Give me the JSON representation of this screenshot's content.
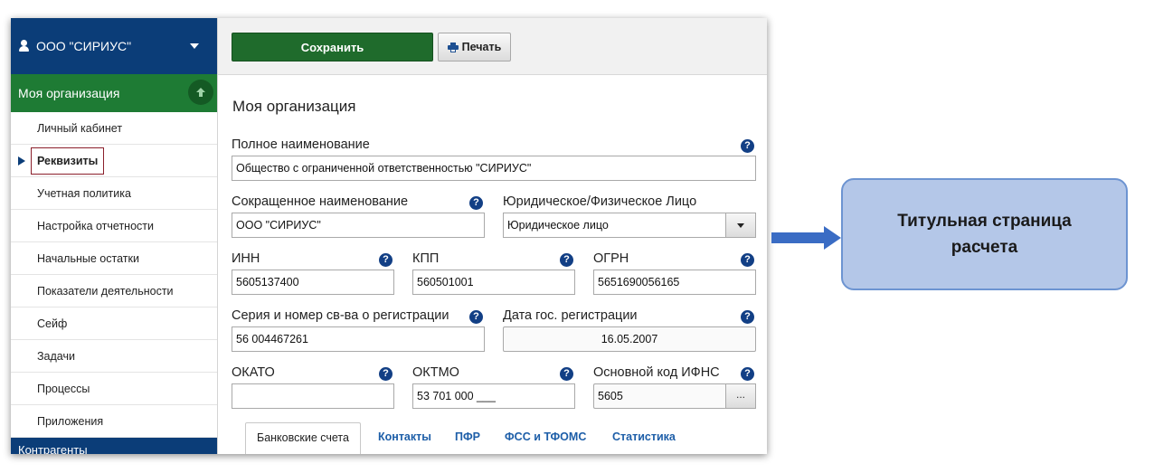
{
  "sidebar": {
    "org_name": "ООО \"СИРИУС\"",
    "section_title": "Моя организация",
    "items": [
      {
        "label": "Личный кабинет"
      },
      {
        "label": "Реквизиты"
      },
      {
        "label": "Учетная политика"
      },
      {
        "label": "Настройка отчетности"
      },
      {
        "label": "Начальные остатки"
      },
      {
        "label": "Показатели деятельности"
      },
      {
        "label": "Сейф"
      },
      {
        "label": "Задачи"
      },
      {
        "label": "Процессы"
      },
      {
        "label": "Приложения"
      }
    ],
    "active_item": "Реквизиты",
    "next_section_partial": "Контрагенты"
  },
  "toolbar": {
    "save_label": "Сохранить",
    "print_label": "Печать"
  },
  "main": {
    "title": "Моя организация",
    "full_name": {
      "label": "Полное наименование",
      "value": "Общество с ограниченной ответственностью \"СИРИУС\""
    },
    "short_name": {
      "label": "Сокращенное наименование",
      "value": "ООО \"СИРИУС\""
    },
    "entity_type": {
      "label": "Юридическое/Физическое Лицо",
      "value": "Юридическое лицо"
    },
    "inn": {
      "label": "ИНН",
      "value": "5605137400"
    },
    "kpp": {
      "label": "КПП",
      "value": "560501001"
    },
    "ogrn": {
      "label": "ОГРН",
      "value": "5651690056165"
    },
    "reg_cert": {
      "label": "Серия и номер св-ва о регистрации",
      "value": "56 004467261"
    },
    "reg_date": {
      "label": "Дата гос. регистрации",
      "value": "16.05.2007"
    },
    "okato": {
      "label": "ОКАТО",
      "value": ""
    },
    "oktmo": {
      "label": "ОКТМО",
      "value": "53 701 000 ___"
    },
    "ifns": {
      "label": "Основной код ИФНС",
      "value": "5605"
    },
    "help_glyph": "?",
    "dots_glyph": "...",
    "tabs": [
      {
        "label": "Банковские счета"
      },
      {
        "label": "Контакты"
      },
      {
        "label": "ПФР"
      },
      {
        "label": "ФСС и ТФОМС"
      },
      {
        "label": "Статистика"
      }
    ]
  },
  "callout": {
    "text": "Титульная страница\nрасчета"
  },
  "colors": {
    "header_blue": "#0b3d78",
    "section_green": "#1e7b34",
    "save_green": "#1f6b2c",
    "help_blue": "#123f85",
    "callout_fill": "#b4c7e8",
    "callout_border": "#6d94d1",
    "arrow_blue": "#3a6cc4",
    "active_outline": "#8b1f2b"
  },
  "icons": {
    "user": "user-icon",
    "caret": "chevron-down-icon",
    "collapse": "arrow-up-circle-icon",
    "printer": "printer-icon",
    "help": "question-circle-icon"
  }
}
